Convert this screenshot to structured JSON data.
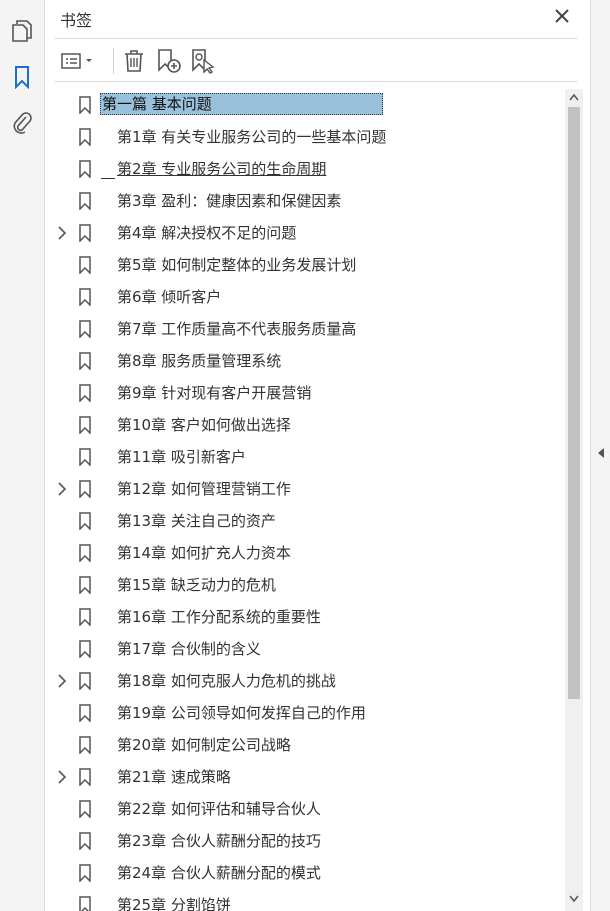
{
  "panel": {
    "title": "书签"
  },
  "left_rail": {
    "items": [
      {
        "name": "pages-icon",
        "active": false
      },
      {
        "name": "bookmarks-icon",
        "active": true
      },
      {
        "name": "attachments-icon",
        "active": false
      }
    ]
  },
  "toolbar": {
    "buttons": [
      "options-menu-icon",
      "delete-icon",
      "new-bookmark-icon",
      "new-bookmark-from-selection-icon"
    ]
  },
  "colors": {
    "accent": "#1a6fd0",
    "selection": "#99c1db",
    "icon": "#555555"
  },
  "bookmarks": [
    {
      "label": "第一篇  基本问题",
      "level": 0,
      "expandable": false,
      "selected": true
    },
    {
      "label": "第1章  有关专业服务公司的一些基本问题",
      "level": 1,
      "expandable": false
    },
    {
      "label": "第2章  专业服务公司的生命周期",
      "level": 1,
      "expandable": false,
      "editing": true
    },
    {
      "label": "第3章  盈利：健康因素和保健因素",
      "level": 1,
      "expandable": false
    },
    {
      "label": "第4章  解决授权不足的问题",
      "level": 1,
      "expandable": true
    },
    {
      "label": "第5章  如何制定整体的业务发展计划",
      "level": 1,
      "expandable": false
    },
    {
      "label": "第6章  倾听客户",
      "level": 1,
      "expandable": false
    },
    {
      "label": "第7章  工作质量高不代表服务质量高",
      "level": 1,
      "expandable": false
    },
    {
      "label": "第8章  服务质量管理系统",
      "level": 1,
      "expandable": false
    },
    {
      "label": "第9章  针对现有客户开展营销",
      "level": 1,
      "expandable": false
    },
    {
      "label": "第10章  客户如何做出选择",
      "level": 1,
      "expandable": false
    },
    {
      "label": "第11章  吸引新客户",
      "level": 1,
      "expandable": false
    },
    {
      "label": "第12章  如何管理营销工作",
      "level": 1,
      "expandable": true
    },
    {
      "label": "第13章  关注自己的资产",
      "level": 1,
      "expandable": false
    },
    {
      "label": "第14章  如何扩充人力资本",
      "level": 1,
      "expandable": false
    },
    {
      "label": "第15章  缺乏动力的危机",
      "level": 1,
      "expandable": false
    },
    {
      "label": "第16章  工作分配系统的重要性",
      "level": 1,
      "expandable": false
    },
    {
      "label": "第17章  合伙制的含义",
      "level": 1,
      "expandable": false
    },
    {
      "label": "第18章  如何克服人力危机的挑战",
      "level": 1,
      "expandable": true
    },
    {
      "label": "第19章  公司领导如何发挥自己的作用",
      "level": 1,
      "expandable": false
    },
    {
      "label": "第20章  如何制定公司战略",
      "level": 1,
      "expandable": false
    },
    {
      "label": "第21章  速成策略",
      "level": 1,
      "expandable": true
    },
    {
      "label": "第22章  如何评估和辅导合伙人",
      "level": 1,
      "expandable": false
    },
    {
      "label": "第23章  合伙人薪酬分配的技巧",
      "level": 1,
      "expandable": false
    },
    {
      "label": "第24章  合伙人薪酬分配的模式",
      "level": 1,
      "expandable": false
    },
    {
      "label": "第25章  分割馅饼",
      "level": 1,
      "expandable": false
    }
  ]
}
